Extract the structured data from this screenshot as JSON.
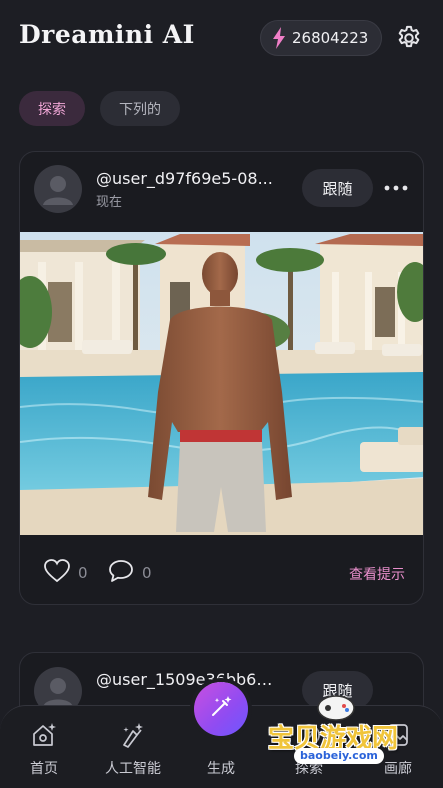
{
  "header": {
    "title": "Dreamini AI",
    "credits": "26804223",
    "accent_color": "#e98fcc"
  },
  "tabs": [
    {
      "label": "探索",
      "active": true
    },
    {
      "label": "下列的",
      "active": false
    }
  ],
  "posts": [
    {
      "username": "@user_d97f69e5-08...",
      "time": "现在",
      "follow_label": "跟随",
      "likes": "0",
      "comments": "0",
      "view_prompt_label": "查看提示"
    },
    {
      "username": "@user_1509e36bb6e...",
      "follow_label": "跟随"
    }
  ],
  "bottom_nav": [
    {
      "label": "首页",
      "icon": "home-sparkle-icon"
    },
    {
      "label": "人工智能",
      "icon": "ai-sparkle-icon"
    },
    {
      "label": "生成",
      "icon": "magic-wand-icon"
    },
    {
      "label": "探索",
      "icon": "explore-icon",
      "active": true
    },
    {
      "label": "画廊",
      "icon": "gallery-icon"
    }
  ],
  "watermark": {
    "text": "宝贝游戏网",
    "url": "baobeiy.com"
  }
}
